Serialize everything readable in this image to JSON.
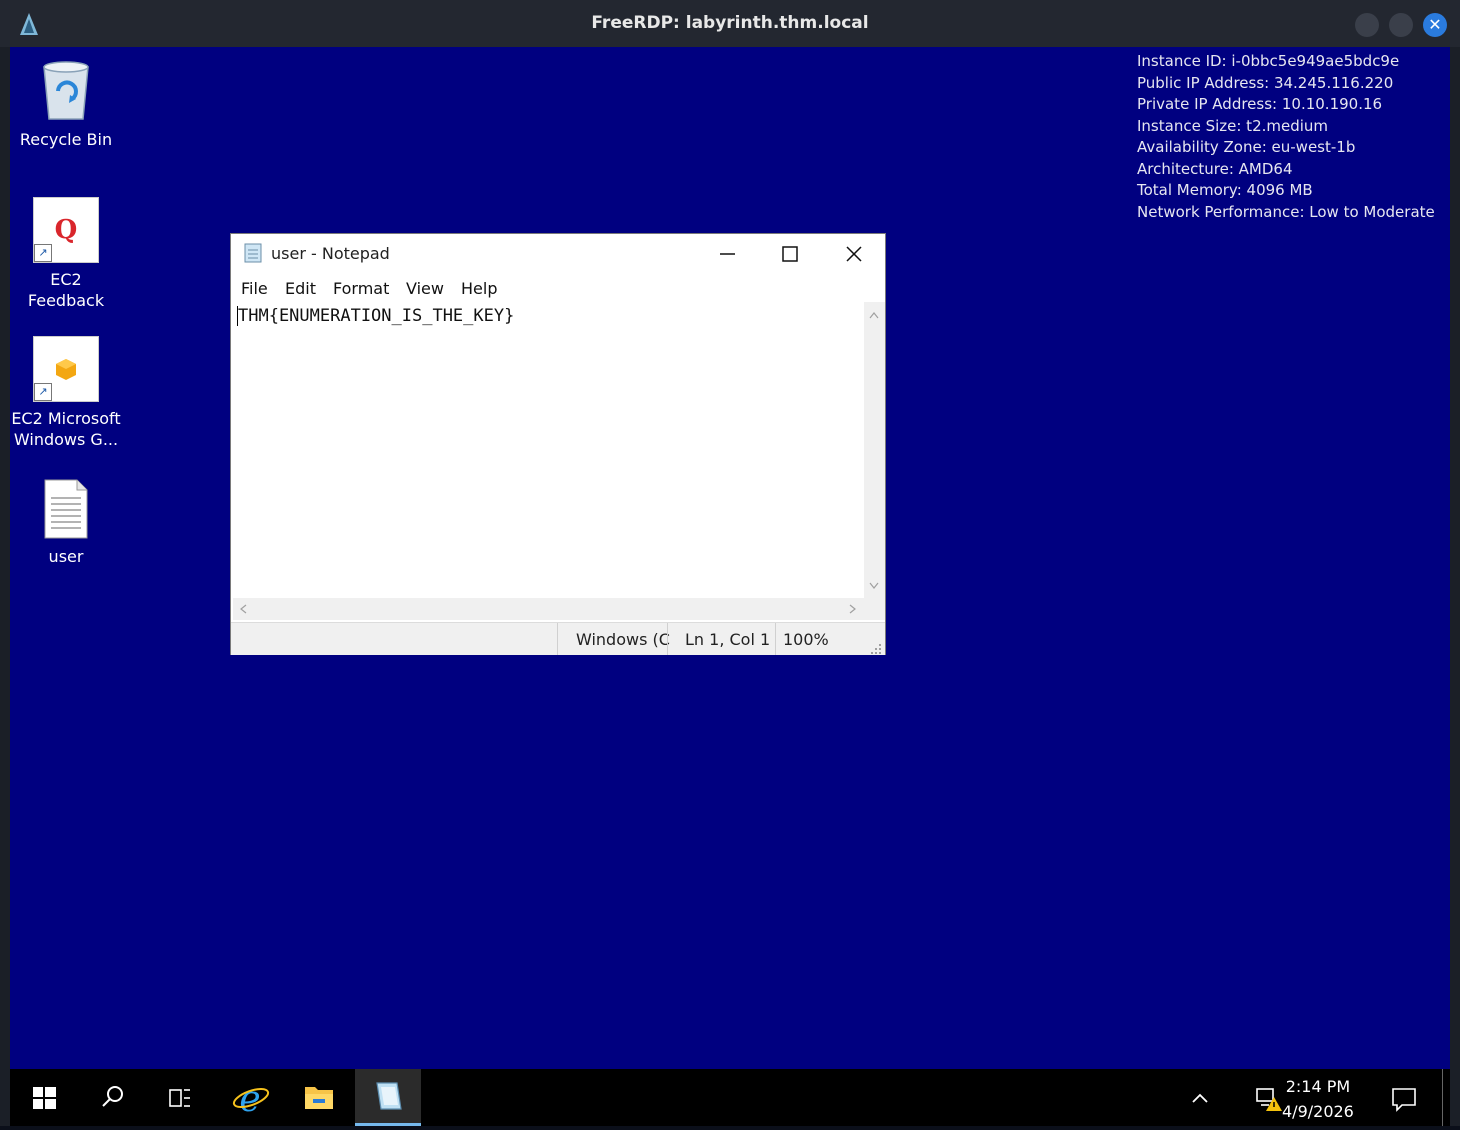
{
  "window": {
    "title": "FreeRDP: labyrinth.thm.local"
  },
  "desktop": {
    "icons": [
      {
        "label": "Recycle Bin"
      },
      {
        "label": "EC2 Feedback"
      },
      {
        "label": "EC2 Microsoft Windows G..."
      },
      {
        "label": "user"
      }
    ],
    "sysinfo": [
      "Instance ID: i-0bbc5e949ae5bdc9e",
      "Public IP Address: 34.245.116.220",
      "Private IP Address: 10.10.190.16",
      "Instance Size: t2.medium",
      "Availability Zone: eu-west-1b",
      "Architecture: AMD64",
      "Total Memory: 4096 MB",
      "Network Performance: Low to Moderate"
    ],
    "background_color": "#000080"
  },
  "notepad": {
    "title": "user - Notepad",
    "menu": [
      "File",
      "Edit",
      "Format",
      "View",
      "Help"
    ],
    "content": "THM{ENUMERATION_IS_THE_KEY}",
    "status": {
      "encoding": "Windows (C",
      "position": "Ln 1, Col 1",
      "zoom": "100%"
    }
  },
  "taskbar": {
    "items": [
      "start-icon",
      "search-icon",
      "task-view-icon",
      "internet-explorer-icon",
      "file-explorer-icon",
      "notepad-icon"
    ],
    "active_item": "notepad-icon",
    "clock_time": "2:14 PM",
    "clock_date": "4/9/2026"
  }
}
